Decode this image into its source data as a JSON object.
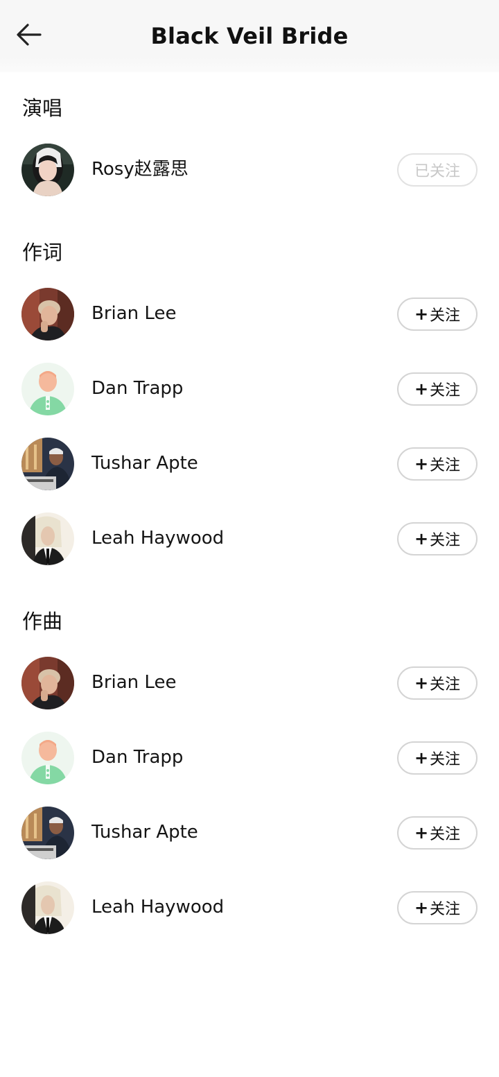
{
  "header": {
    "title": "Black Veil Bride",
    "back_icon": "arrow-left-icon"
  },
  "sections": [
    {
      "title": "演唱",
      "people": [
        {
          "name": "Rosy赵露思",
          "button": "已关注",
          "followed": true
        }
      ]
    },
    {
      "title": "作词",
      "people": [
        {
          "name": "Brian Lee",
          "button": "关注",
          "followed": false
        },
        {
          "name": "Dan Trapp",
          "button": "关注",
          "followed": false
        },
        {
          "name": "Tushar Apte",
          "button": "关注",
          "followed": false
        },
        {
          "name": "Leah Haywood",
          "button": "关注",
          "followed": false
        }
      ]
    },
    {
      "title": "作曲",
      "people": [
        {
          "name": "Brian Lee",
          "button": "关注",
          "followed": false
        },
        {
          "name": "Dan Trapp",
          "button": "关注",
          "followed": false
        },
        {
          "name": "Tushar Apte",
          "button": "关注",
          "followed": false
        },
        {
          "name": "Leah Haywood",
          "button": "关注",
          "followed": false
        }
      ]
    }
  ],
  "follow_plus": "+",
  "colors": {
    "border": "#d4d4d4",
    "followed_text": "#c8c8c8",
    "header_bg": "#f7f7f7"
  }
}
